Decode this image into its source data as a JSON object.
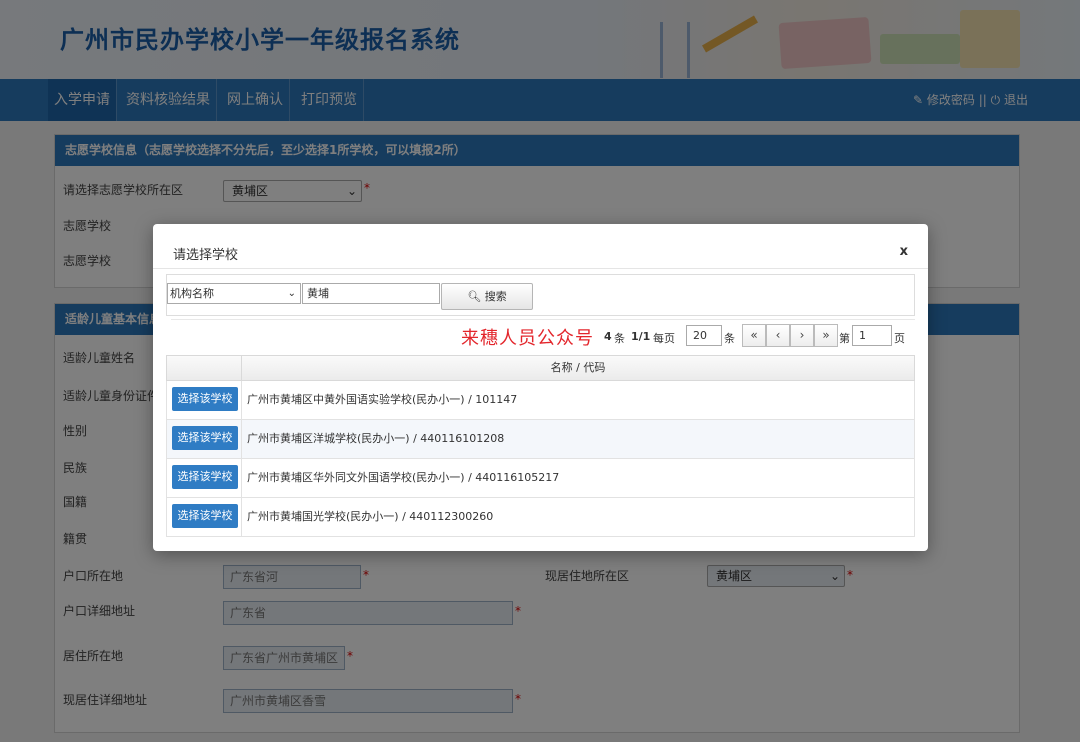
{
  "header": {
    "title": "广州市民办学校小学一年级报名系统"
  },
  "nav": {
    "items": [
      {
        "label": "入学申请"
      },
      {
        "label": "资料核验结果"
      },
      {
        "label": "网上确认"
      },
      {
        "label": "打印预览"
      }
    ],
    "right": {
      "change_password": "修改密码",
      "separator": "||",
      "logout": "退出"
    }
  },
  "school_panel": {
    "title": "志愿学校信息（志愿学校选择不分先后，至少选择1所学校，可以填报2所）",
    "district_label": "请选择志愿学校所在区",
    "district_value": "黄埔区",
    "school1_label": "志愿学校",
    "school2_label": "志愿学校"
  },
  "child_panel": {
    "title": "适龄儿童基本信息",
    "labels": [
      "适龄儿童姓名",
      "适龄儿童身份证件",
      "性别",
      "民族",
      "国籍",
      "籍贯",
      "户口所在地",
      "户口详细地址",
      "居住所在地",
      "现居住详细地址"
    ],
    "hukou_value": "广东省河",
    "hukou_addr_value": "广东省",
    "residence_value": "广东省广州市黄埔区",
    "residence_addr_value": "广州市黄埔区香雪",
    "current_district_label": "现居住地所在区",
    "current_district_value": "黄埔区"
  },
  "modal": {
    "title": "请选择学校",
    "close": "x",
    "search": {
      "field_value": "机构名称",
      "keyword": "黄埔",
      "button_label": "搜索"
    },
    "watermark": "来穗人员公众号",
    "pager": {
      "total": "4",
      "total_unit": "条",
      "page_of": "1/1",
      "per_page_label": "每页",
      "per_page_value": "20",
      "per_page_unit": "条",
      "goto_prefix": "第",
      "goto_value": "1",
      "goto_suffix": "页"
    },
    "table": {
      "header": "名称 / 代码",
      "button_label": "选择该学校",
      "rows": [
        {
          "text": "广州市黄埔区中黄外国语实验学校(民办小一) / 101147"
        },
        {
          "text": "广州市黄埔区洋城学校(民办小一) / 440116101208"
        },
        {
          "text": "广州市黄埔区华外同文外国语学校(民办小一) / 440116105217"
        },
        {
          "text": "广州市黄埔国光学校(民办小一) / 440112300260"
        }
      ]
    }
  }
}
